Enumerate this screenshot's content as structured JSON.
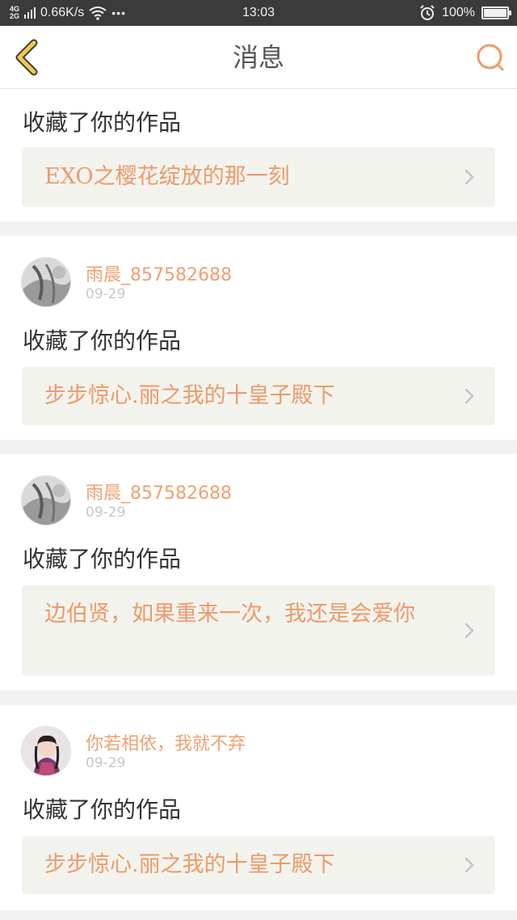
{
  "status_bar": {
    "network_top": "4G",
    "network_bottom": "2G",
    "speed": "0.66K/s",
    "more": "•••",
    "time": "13:03",
    "battery": "100%",
    "battery_level": 1.0
  },
  "header": {
    "title": "消息",
    "back_icon": "chevron-left-icon",
    "search_icon": "search-icon",
    "accent_color": "#f2c94c",
    "search_color": "#f29a67"
  },
  "messages": [
    {
      "action": "收藏了你的作品",
      "work_title": "EXO之樱花绽放的那一刻"
    },
    {
      "username": "雨晨_857582688",
      "date": "09-29",
      "action": "收藏了你的作品",
      "work_title": "步步惊心.丽之我的十皇子殿下"
    },
    {
      "username": "雨晨_857582688",
      "date": "09-29",
      "action": "收藏了你的作品",
      "work_title": "边伯贤，如果重来一次，我还是会爱你"
    },
    {
      "username": "你若相依，我就不弃",
      "date": "09-29",
      "action": "收藏了你的作品",
      "work_title": "步步惊心.丽之我的十皇子殿下"
    }
  ]
}
